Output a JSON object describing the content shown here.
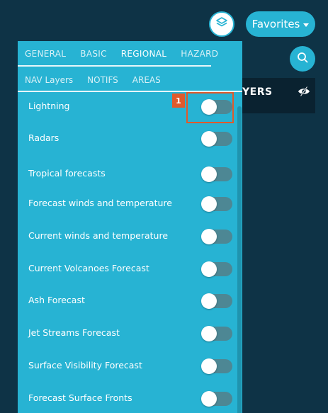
{
  "topbar": {
    "favorites_label": "Favorites"
  },
  "dark_panel": {
    "title": "YERS"
  },
  "tabs": {
    "row1": [
      "GENERAL",
      "BASIC",
      "REGIONAL",
      "HAZARD"
    ],
    "row2": [
      "NAV Layers",
      "NOTIFS",
      "AREAS"
    ],
    "active": "REGIONAL"
  },
  "layers": [
    {
      "label": "Lightning",
      "enabled": false
    },
    {
      "label": "Radars",
      "enabled": false
    },
    {
      "label": "Tropical forecasts",
      "enabled": false
    },
    {
      "label": "Forecast winds and temperature",
      "enabled": false
    },
    {
      "label": "Current winds and temperature",
      "enabled": false
    },
    {
      "label": "Current Volcanoes Forecast",
      "enabled": false
    },
    {
      "label": "Ash Forecast",
      "enabled": false
    },
    {
      "label": "Jet Streams Forecast",
      "enabled": false
    },
    {
      "label": "Surface Visibility Forecast",
      "enabled": false
    },
    {
      "label": "Forecast Surface Fronts",
      "enabled": false
    }
  ],
  "annotation": {
    "badge": "1"
  },
  "colors": {
    "background": "#0e3346",
    "accent": "#27b3d3",
    "toggle_off": "#4d8794",
    "highlight": "#e05a2b"
  }
}
